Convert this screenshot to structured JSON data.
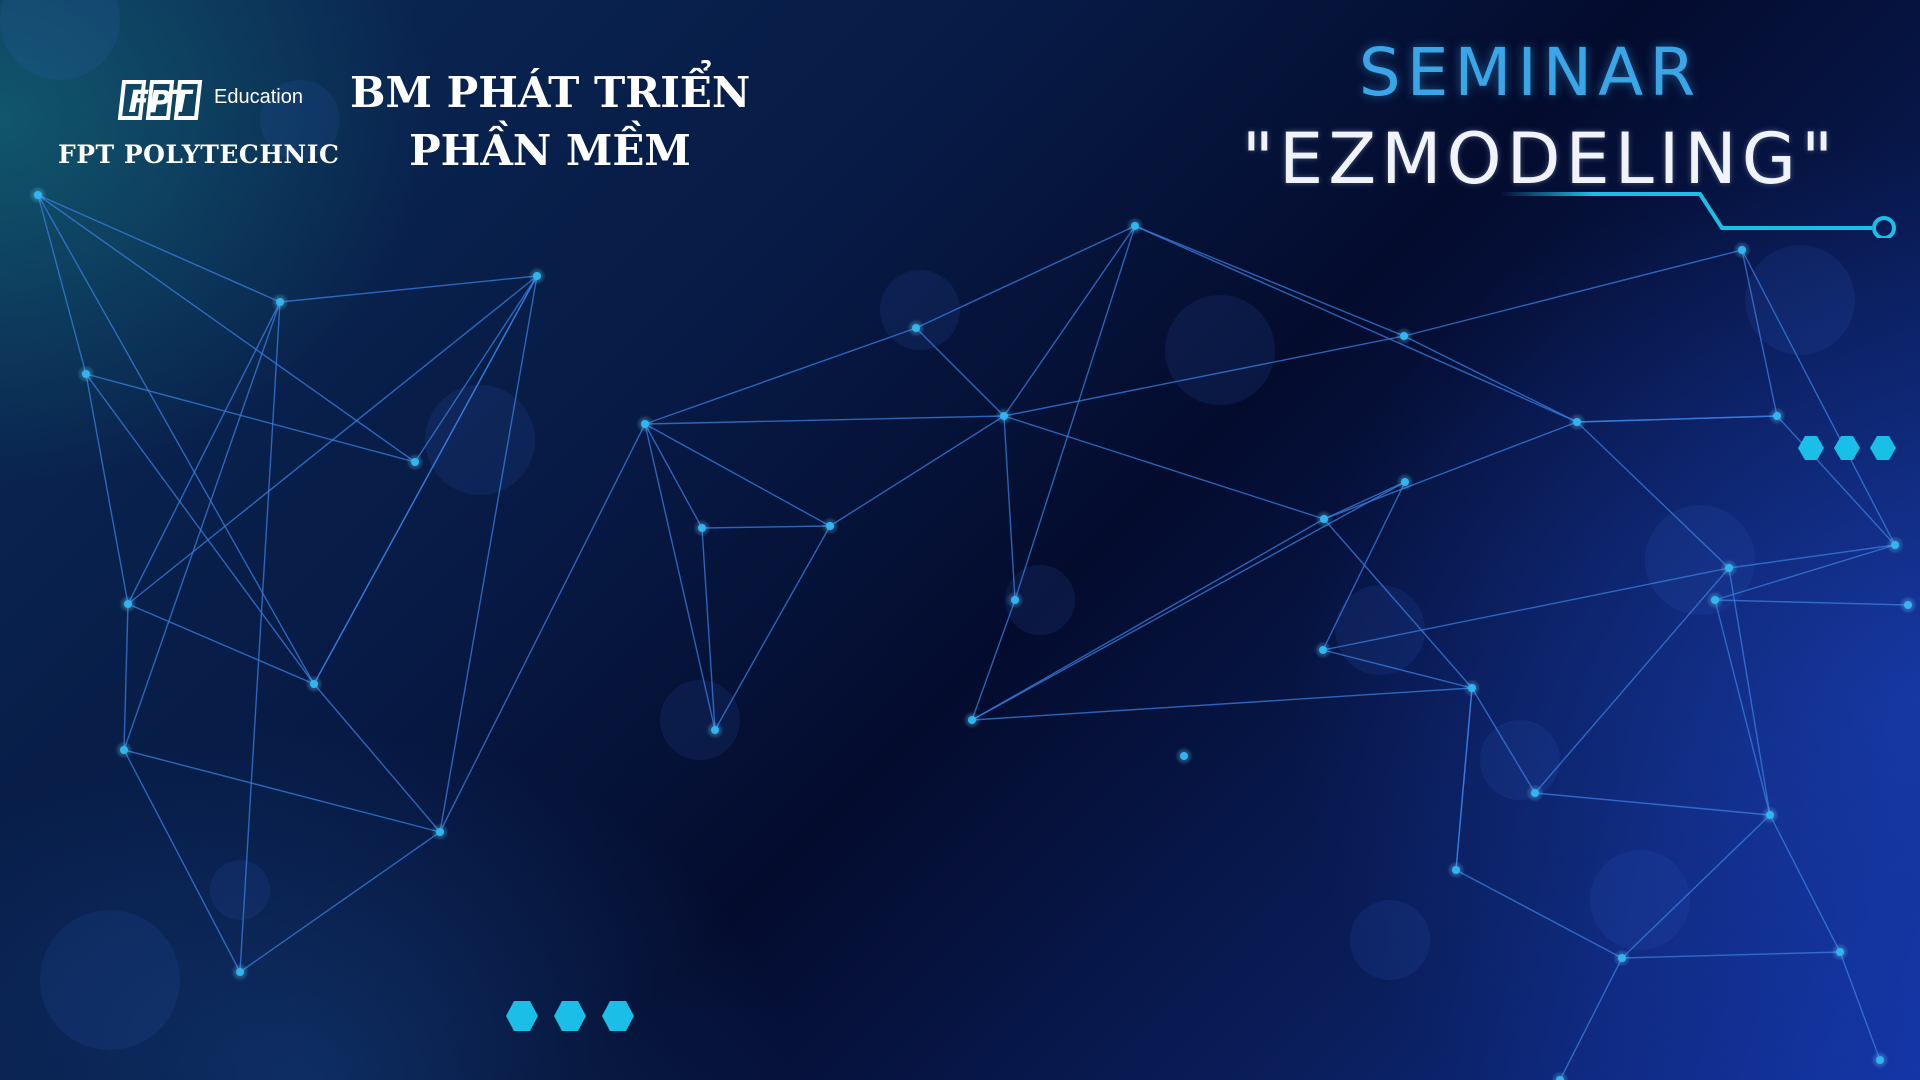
{
  "branding": {
    "logo_text": "FPT",
    "education_label": "Education",
    "school_name": "FPT POLYTECHNIC"
  },
  "department": {
    "line1": "BM PHÁT TRIỂN",
    "line2": "PHẦN MỀM"
  },
  "seminar": {
    "label": "SEMINAR",
    "title": "\"EZMODELING\""
  },
  "colors": {
    "node": "#2fb6f0",
    "line": "#3a7fe0",
    "seminar_label": "#3aa6e8",
    "hex_accent": "#19bfe6"
  },
  "icons": {
    "fpt_logo": "fpt-logo-icon",
    "hexagon_dots": "hexagon-icon",
    "circuit_line": "circuit-line-icon"
  }
}
